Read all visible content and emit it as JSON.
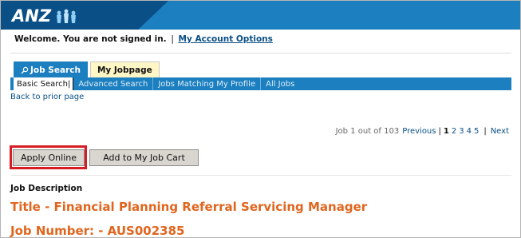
{
  "brand": {
    "logo_text": "ANZ",
    "colors": {
      "banner": "#1c7fc0",
      "banner_dark": "#0a4f86",
      "accent_orange": "#e0651e",
      "highlight_red": "#d81c24"
    }
  },
  "welcome": {
    "message": "Welcome. You are not signed in.",
    "separator": "|",
    "account_link": "My Account Options"
  },
  "tabs": [
    {
      "label": "Job Search",
      "icon": "search-icon",
      "active": true
    },
    {
      "label": "My Jobpage",
      "active": false
    }
  ],
  "subnav": [
    {
      "label": "Basic Search",
      "separator": "|",
      "selected": true
    },
    {
      "label": "Advanced Search"
    },
    {
      "label": "Jobs Matching My Profile"
    },
    {
      "label": "All Jobs"
    }
  ],
  "back_link": "Back to prior page",
  "pager": {
    "status": "Job 1 out of 103",
    "previous": "Previous",
    "bar": "|",
    "pages": [
      "1",
      "2",
      "3",
      "4",
      "5"
    ],
    "current_page": "1",
    "next_bar": "|",
    "next": "Next"
  },
  "actions": {
    "apply": "Apply Online",
    "cart": "Add to My Job Cart"
  },
  "job": {
    "description_label": "Job Description",
    "title": "Title - Financial Planning Referral Servicing Manager",
    "number": "Job Number: - AUS002385"
  }
}
